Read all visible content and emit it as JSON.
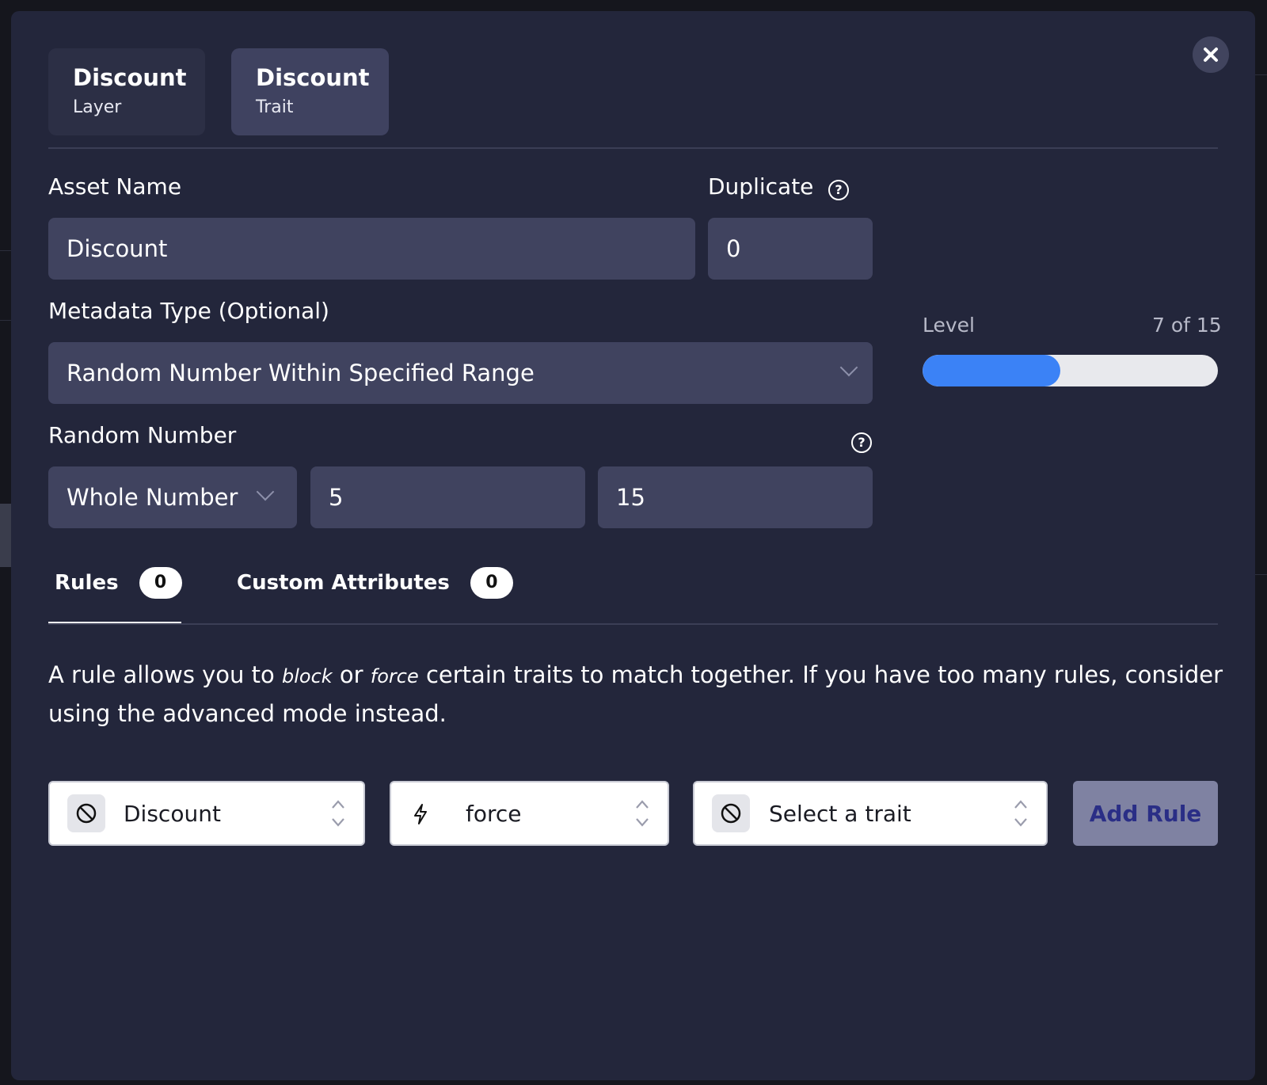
{
  "layer_tabs": [
    {
      "title": "Discount",
      "subtitle": "Layer"
    },
    {
      "title": "Discount",
      "subtitle": "Trait"
    }
  ],
  "asset_name": {
    "label": "Asset Name",
    "value": "Discount"
  },
  "duplicate": {
    "label": "Duplicate",
    "value": "0"
  },
  "metadata_type": {
    "label": "Metadata Type (Optional)",
    "value": "Random Number Within Specified Range"
  },
  "level": {
    "label": "Level",
    "value_text": "7 of 15",
    "current": 7,
    "max": 15
  },
  "random_number": {
    "label": "Random Number",
    "type": "Whole Number",
    "min": "5",
    "max": "15"
  },
  "subtabs": [
    {
      "label": "Rules",
      "count": "0"
    },
    {
      "label": "Custom Attributes",
      "count": "0"
    }
  ],
  "rules": {
    "desc_before": "A rule allows you to ",
    "desc_block": "block",
    "desc_or": " or ",
    "desc_force": "force",
    "desc_after": " certain traits to match together. If you have too many rules, consider using the advanced mode instead.",
    "trait_a": "Discount",
    "operator": "force",
    "trait_b_placeholder": "Select a trait",
    "add_button": "Add Rule"
  },
  "colors": {
    "accent": "#3b82f6",
    "modal_bg": "#23263b",
    "field_bg": "#40435f"
  }
}
